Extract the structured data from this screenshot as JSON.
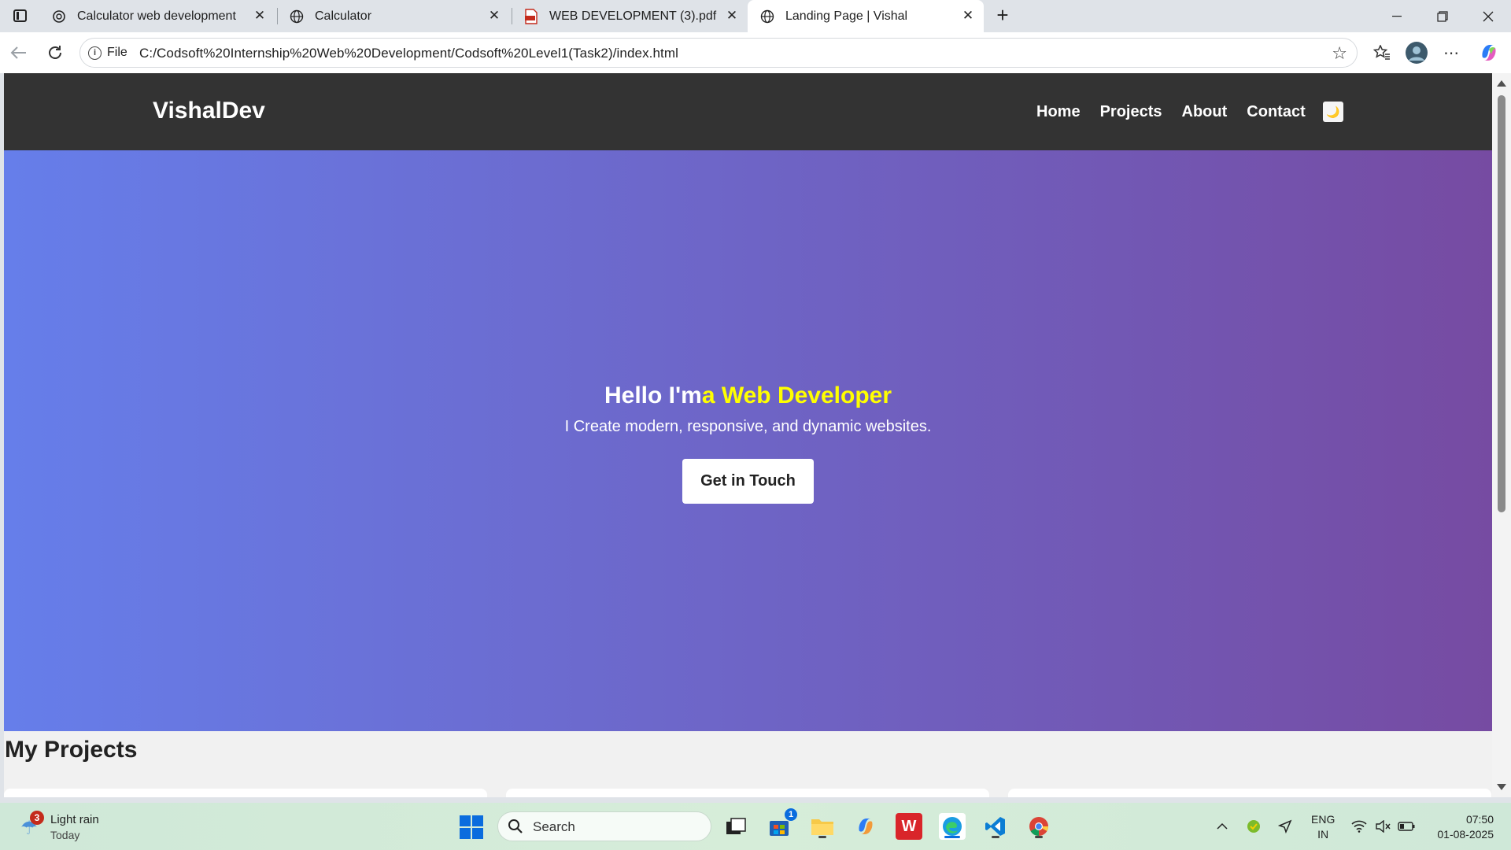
{
  "browser": {
    "tabs": [
      {
        "title": "Calculator web development",
        "icon": "openai-icon",
        "active": false
      },
      {
        "title": "Calculator",
        "icon": "globe-icon",
        "active": false
      },
      {
        "title": "WEB DEVELOPMENT (3).pdf",
        "icon": "pdf-icon",
        "active": false
      },
      {
        "title": "Landing Page | Vishal",
        "icon": "globe-icon",
        "active": true
      }
    ],
    "address": {
      "scheme_label": "File",
      "url": "C:/Codsoft%20Internship%20Web%20Development/Codsoft%20Level1(Task2)/index.html"
    }
  },
  "site": {
    "brand": "VishalDev",
    "nav": [
      "Home",
      "Projects",
      "About",
      "Contact"
    ],
    "theme_toggle_icon": "moon-icon",
    "hero": {
      "title_prefix": "Hello I'm",
      "title_accent": "a Web Developer",
      "subtitle": "I Create modern, responsive, and dynamic websites.",
      "cta": "Get in Touch",
      "gradient_start": "#667eea",
      "gradient_end": "#764ba2",
      "accent_color": "#ffff00"
    },
    "projects_heading": "My Projects"
  },
  "taskbar": {
    "weather": {
      "badge": "3",
      "condition": "Light rain",
      "when": "Today"
    },
    "search_placeholder": "Search",
    "store_badge": "1",
    "language": {
      "line1": "ENG",
      "line2": "IN"
    },
    "clock": {
      "time": "07:50",
      "date": "01-08-2025"
    }
  }
}
